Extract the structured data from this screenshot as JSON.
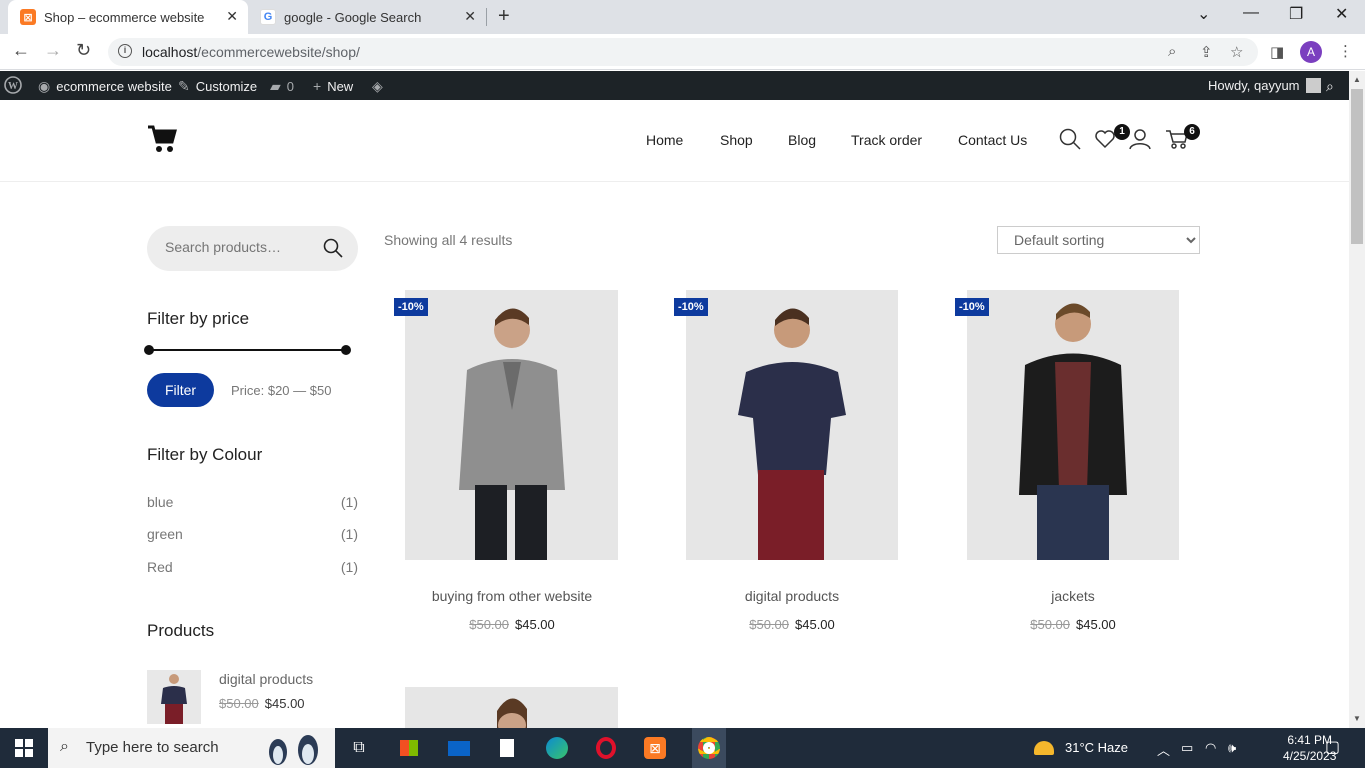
{
  "browser": {
    "tabs": [
      {
        "title": "Shop – ecommerce website"
      },
      {
        "title": "google - Google Search"
      }
    ],
    "url_host": "localhost",
    "url_path": "/ecommercewebsite/shop/",
    "profile_initial": "A"
  },
  "wpbar": {
    "site": "ecommerce website",
    "customize": "Customize",
    "comments": "0",
    "new": "New",
    "howdy": "Howdy, qayyum"
  },
  "nav": {
    "home": "Home",
    "shop": "Shop",
    "blog": "Blog",
    "track": "Track order",
    "contact": "Contact Us",
    "wishlist_count": "1",
    "cart_count": "6"
  },
  "sidebar": {
    "search_placeholder": "Search products…",
    "price_title": "Filter by price",
    "filter_label": "Filter",
    "price_range": "Price: $20 — $50",
    "colour_title": "Filter by Colour",
    "colours": [
      {
        "name": "blue",
        "count": "(1)"
      },
      {
        "name": "green",
        "count": "(1)"
      },
      {
        "name": "Red",
        "count": "(1)"
      }
    ],
    "products_title": "Products",
    "products": [
      {
        "name": "digital products",
        "old_price": "$50.00",
        "price": "$45.00"
      }
    ]
  },
  "shop": {
    "result_count": "Showing all 4 results",
    "sorting": "Default sorting",
    "products": [
      {
        "title": "buying from other website",
        "sale": "-10%",
        "old_price": "$50.00",
        "price": "$45.00"
      },
      {
        "title": "digital products",
        "sale": "-10%",
        "old_price": "$50.00",
        "price": "$45.00"
      },
      {
        "title": "jackets",
        "sale": "-10%",
        "old_price": "$50.00",
        "price": "$45.00"
      }
    ]
  },
  "taskbar": {
    "search_placeholder": "Type here to search",
    "weather": "31°C  Haze",
    "time": "6:41 PM",
    "date": "4/25/2023"
  }
}
